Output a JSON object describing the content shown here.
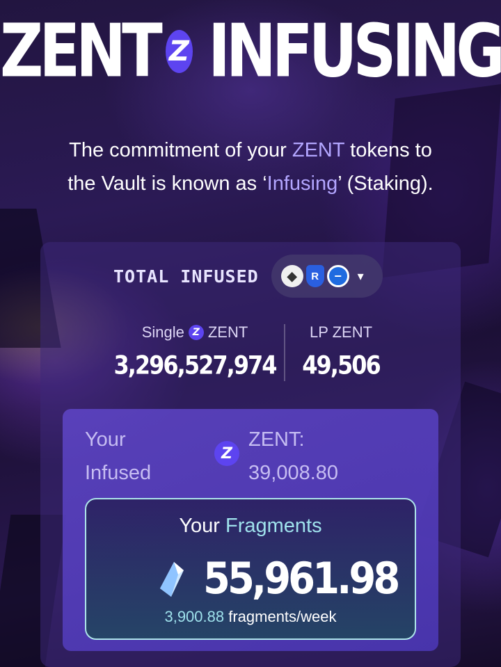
{
  "header": {
    "title_left": "ZENT",
    "title_right": "INFUSING",
    "logo_glyph": "Z"
  },
  "intro": {
    "line1_a": "The commitment of your ",
    "line1_highlight": "ZENT",
    "line1_b": " tokens to",
    "line2_a": "the Vault is known as ‘",
    "line2_highlight": "Infusing",
    "line2_b": "’ (Staking)."
  },
  "total": {
    "label": "TOTAL INFUSED",
    "chains": [
      {
        "name": "ethereum-icon",
        "glyph": "◆"
      },
      {
        "name": "shield-chain-icon",
        "glyph": "R"
      },
      {
        "name": "minus-chain-icon",
        "glyph": "−"
      }
    ],
    "dropdown_glyph": "▾"
  },
  "stats": {
    "single_label": "Single",
    "single_token": "ZENT",
    "single_value": "3,296,527,974",
    "lp_label": "LP ZENT",
    "lp_value": "49,506"
  },
  "user": {
    "infused_label_1": "Your",
    "infused_label_2": "Infused",
    "token_label": "ZENT:",
    "token_amount": "39,008.80"
  },
  "fragments": {
    "title_a": "Your ",
    "title_highlight": "Fragments",
    "value": "55,961.98",
    "rate_value": "3,900.88",
    "rate_unit": " fragments/week"
  },
  "colors": {
    "accent": "#5d44f0",
    "highlight": "#b3a6ff",
    "fragment_accent": "#9fe2ec"
  }
}
